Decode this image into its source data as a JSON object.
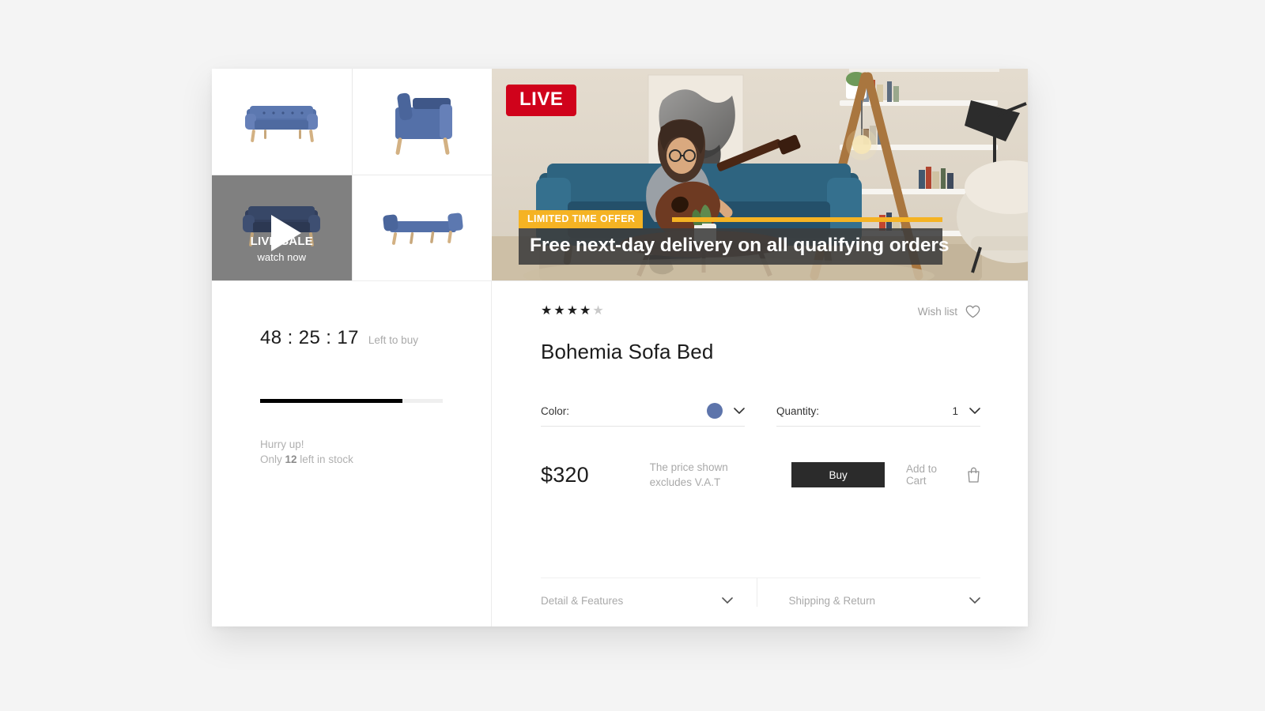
{
  "gallery": {
    "thumbnails": [
      {
        "name": "sofa-front-view",
        "alt": "Blue sofa front view"
      },
      {
        "name": "sofa-side-view",
        "alt": "Blue sofa side view"
      },
      {
        "name": "sofa-bed-flat-view",
        "alt": "Blue sofa bed folded flat"
      }
    ],
    "video_tile": {
      "title": "LIVE SALE",
      "subtitle": "watch now",
      "play_icon": "play-icon"
    }
  },
  "hero": {
    "live_badge": "LIVE",
    "offer_tag": "LIMITED TIME OFFER",
    "offer_text": "Free next-day delivery on all qualifying orders",
    "alt": "Woman playing guitar on a blue sofa in a living room"
  },
  "deal": {
    "timer": "48 : 25 : 17",
    "timer_label": "Left to buy",
    "progress_percent": 78,
    "stock_line1": "Hurry up!",
    "stock_prefix": "Only ",
    "stock_count": "12",
    "stock_suffix": " left in stock"
  },
  "product": {
    "rating": 4,
    "rating_max": 5,
    "star_on": "★",
    "star_off": "★",
    "wish_list_label": "Wish list",
    "wish_list_icon": "heart-icon",
    "title": "Bohemia Sofa Bed",
    "price": "$320",
    "vat_line1": "The price shown",
    "vat_line2": "excludes V.A.T"
  },
  "options": {
    "color": {
      "label": "Color:",
      "value_icon": "color-swatch",
      "value_hex": "#5d74ab",
      "chevron": "chevron-down-icon"
    },
    "quantity": {
      "label": "Quantity:",
      "value": "1",
      "chevron": "chevron-down-icon"
    }
  },
  "actions": {
    "buy_label": "Buy",
    "add_to_cart_label": "Add to Cart",
    "cart_icon": "shopping-bag-icon"
  },
  "accordions": [
    {
      "label": "Detail & Features",
      "chevron": "chevron-down-icon"
    },
    {
      "label": "Shipping & Return",
      "chevron": "chevron-down-icon"
    }
  ],
  "colors": {
    "live_red": "#d0021b",
    "offer_yellow": "#f5b323",
    "swatch_blue": "#5d74ab",
    "buy_dark": "#2b2b2b"
  }
}
